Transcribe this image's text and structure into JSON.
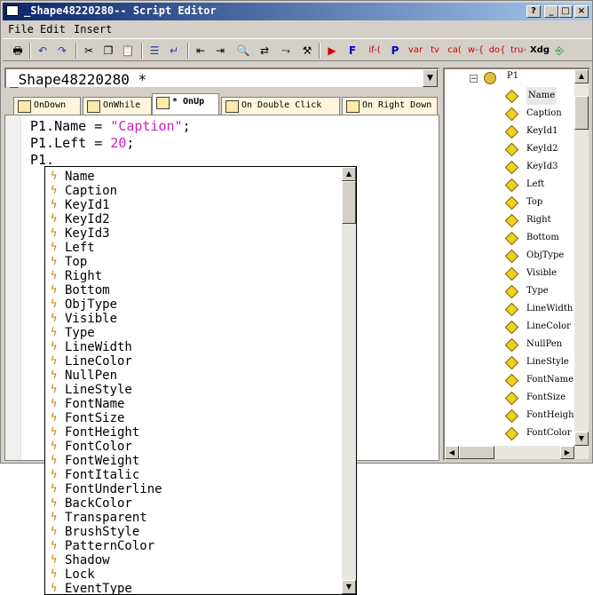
{
  "window": {
    "title": "_Shape48220280-- Script Editor",
    "controls": [
      "?",
      "_",
      "□",
      "×"
    ]
  },
  "menu": [
    {
      "label": "File"
    },
    {
      "label": "Edit"
    },
    {
      "label": "Insert"
    }
  ],
  "toolbar": {
    "text_buttons": [
      {
        "label": "F",
        "color": "#0000cc"
      },
      {
        "label": "if-(",
        "color": "#cc0000"
      },
      {
        "label": "P",
        "color": "#0000cc"
      },
      {
        "label": "var",
        "color": "#cc0000"
      },
      {
        "label": "tv",
        "color": "#cc0000"
      },
      {
        "label": "ca(",
        "color": "#cc0000"
      },
      {
        "label": "w-{",
        "color": "#cc0000"
      },
      {
        "label": "do{",
        "color": "#cc0000"
      },
      {
        "label": "tru-",
        "color": "#cc0000"
      },
      {
        "label": "Xdg",
        "color": "#000000"
      }
    ]
  },
  "object_selector": {
    "value": "_Shape48220280 *"
  },
  "tabs": [
    {
      "label": "OnDown"
    },
    {
      "label": "OnWhile"
    },
    {
      "label": "* OnUp"
    },
    {
      "label": "On Double Click"
    },
    {
      "label": "On Right Down"
    }
  ],
  "code": {
    "line1_prefix": "P1.Name = ",
    "line1_string": "\"Caption\"",
    "line1_suffix": ";",
    "line2_prefix": "P1.Left = ",
    "line2_number": "20",
    "line2_suffix": ";",
    "line3": "P1."
  },
  "tree": {
    "root": "P1",
    "items": [
      "Name",
      "Caption",
      "KeyId1",
      "KeyId2",
      "KeyId3",
      "Left",
      "Top",
      "Right",
      "Bottom",
      "ObjType",
      "Visible",
      "Type",
      "LineWidth",
      "LineColor",
      "NullPen",
      "LineStyle",
      "FontName",
      "FontSize",
      "FontHeigh",
      "FontColor"
    ]
  },
  "autocomplete": {
    "items": [
      "Name",
      "Caption",
      "KeyId1",
      "KeyId2",
      "KeyId3",
      "Left",
      "Top",
      "Right",
      "Bottom",
      "ObjType",
      "Visible",
      "Type",
      "LineWidth",
      "LineColor",
      "NullPen",
      "LineStyle",
      "FontName",
      "FontSize",
      "FontHeight",
      "FontColor",
      "FontWeight",
      "FontItalic",
      "FontUnderline",
      "BackColor",
      "Transparent",
      "BrushStyle",
      "PatternColor",
      "Shadow",
      "Lock",
      "EventType"
    ]
  },
  "colors": {
    "title_gradient_start": "#0a246a",
    "string_literal": "#d020c0",
    "tab_background": "#fff5dc"
  }
}
